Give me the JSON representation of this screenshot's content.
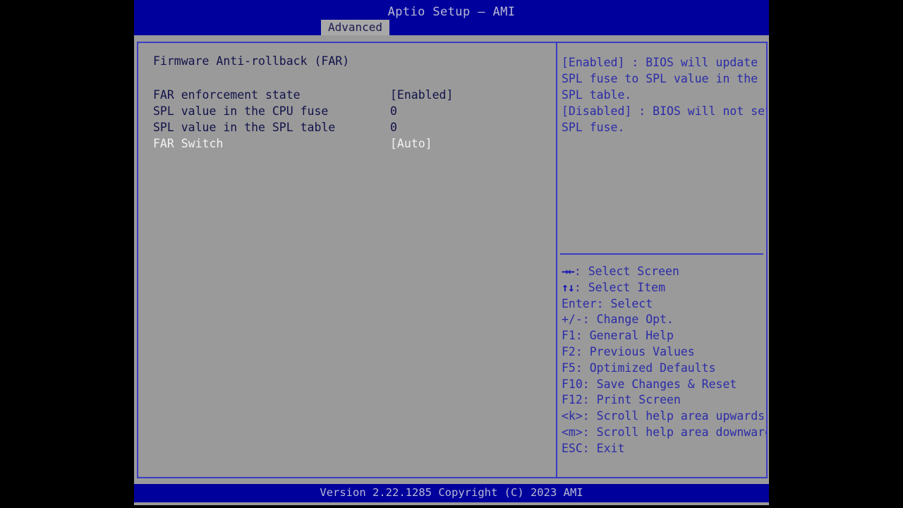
{
  "header": {
    "title": "Aptio Setup – AMI",
    "tabs": [
      {
        "label": "Advanced",
        "active": true
      }
    ]
  },
  "main": {
    "section_title": "Firmware Anti-rollback (FAR)",
    "settings": [
      {
        "label": "FAR enforcement state",
        "value": "[Enabled]",
        "selected": false
      },
      {
        "label": "SPL value in the CPU fuse",
        "value": "0",
        "selected": false
      },
      {
        "label": "SPL value in the SPL table",
        "value": "0",
        "selected": false
      },
      {
        "label": "FAR Switch",
        "value": "[Auto]",
        "selected": true
      }
    ]
  },
  "help": {
    "lines": [
      "[Enabled] : BIOS will update",
      "SPL fuse to SPL value in the",
      "SPL table.",
      "[Disabled] : BIOS will not set",
      "SPL fuse."
    ]
  },
  "keys": [
    {
      "glyph": "→←",
      "text": ": Select Screen"
    },
    {
      "glyph": "↑↓",
      "text": ": Select Item"
    },
    {
      "glyph": "",
      "text": "Enter: Select"
    },
    {
      "glyph": "",
      "text": "+/-: Change Opt."
    },
    {
      "glyph": "",
      "text": "F1: General Help"
    },
    {
      "glyph": "",
      "text": "F2: Previous Values"
    },
    {
      "glyph": "",
      "text": "F5: Optimized Defaults"
    },
    {
      "glyph": "",
      "text": "F10: Save Changes & Reset"
    },
    {
      "glyph": "",
      "text": "F12: Print Screen"
    },
    {
      "glyph": "",
      "text": "<k>: Scroll help area upwards"
    },
    {
      "glyph": "",
      "text": "<m>: Scroll help area downwards"
    },
    {
      "glyph": "",
      "text": "ESC: Exit"
    }
  ],
  "footer": {
    "version_text": "Version 2.22.1285 Copyright (C) 2023 AMI"
  },
  "colors": {
    "header_blue": "#00009c",
    "panel_gray": "#9a9a9a",
    "border_blue": "#3b3bc4",
    "text_dark": "#12124a",
    "text_help": "#2b2ba8",
    "text_selected": "#f2f2f2",
    "title_text": "#b9b9d6"
  }
}
